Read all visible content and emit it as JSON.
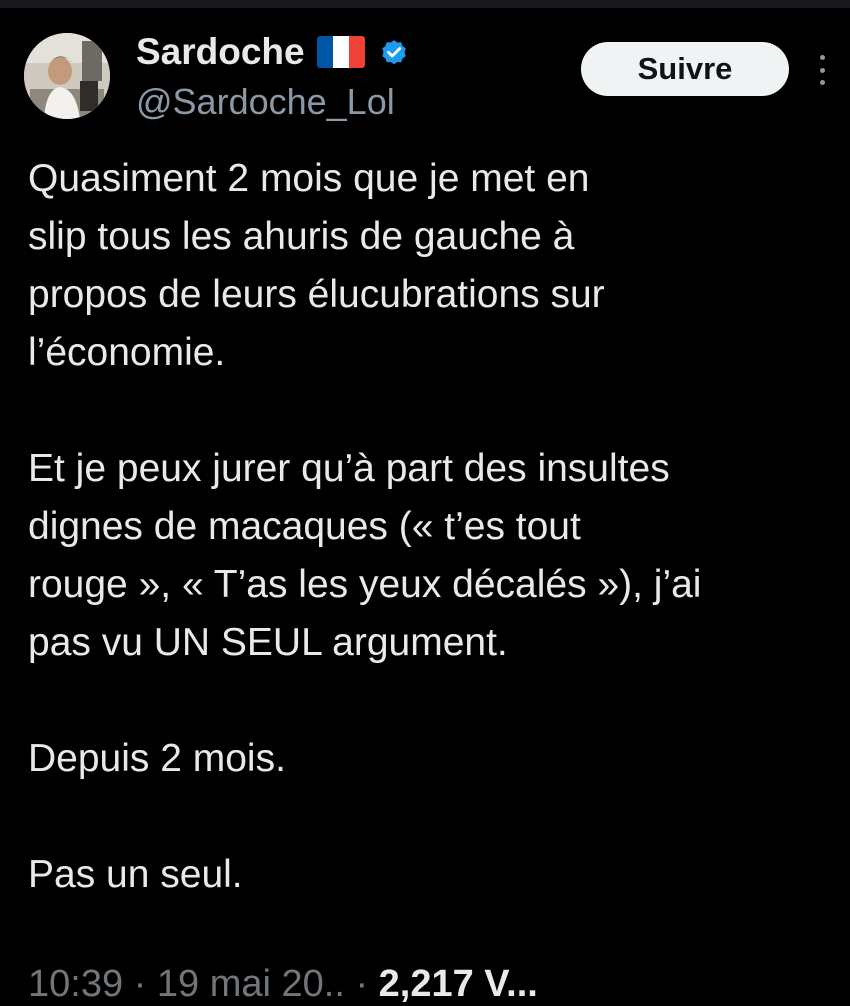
{
  "author": {
    "display_name": "Sardoche",
    "handle": "@Sardoche_Lol",
    "flag_icon": "france-flag-icon",
    "verified_icon": "verified-badge-icon",
    "verified_color": "#1d9bf0"
  },
  "actions": {
    "follow_label": "Suivre",
    "more_icon": "more-vertical-icon"
  },
  "tweet": {
    "paragraphs": [
      "Quasiment 2 mois que je met en\nslip tous les ahuris de gauche à\npropos de leurs élucubrations sur\nl’économie.",
      "Et je peux jurer qu’à part des insultes\ndignes de macaques (« t’es tout\nrouge », « T’as les yeux décalés »), j’ai\npas vu UN SEUL argument.",
      "Depuis 2 mois.",
      "Pas un seul."
    ]
  },
  "meta": {
    "time": "10:39",
    "date": "19 mai 20..",
    "views": "2,217 V..."
  }
}
